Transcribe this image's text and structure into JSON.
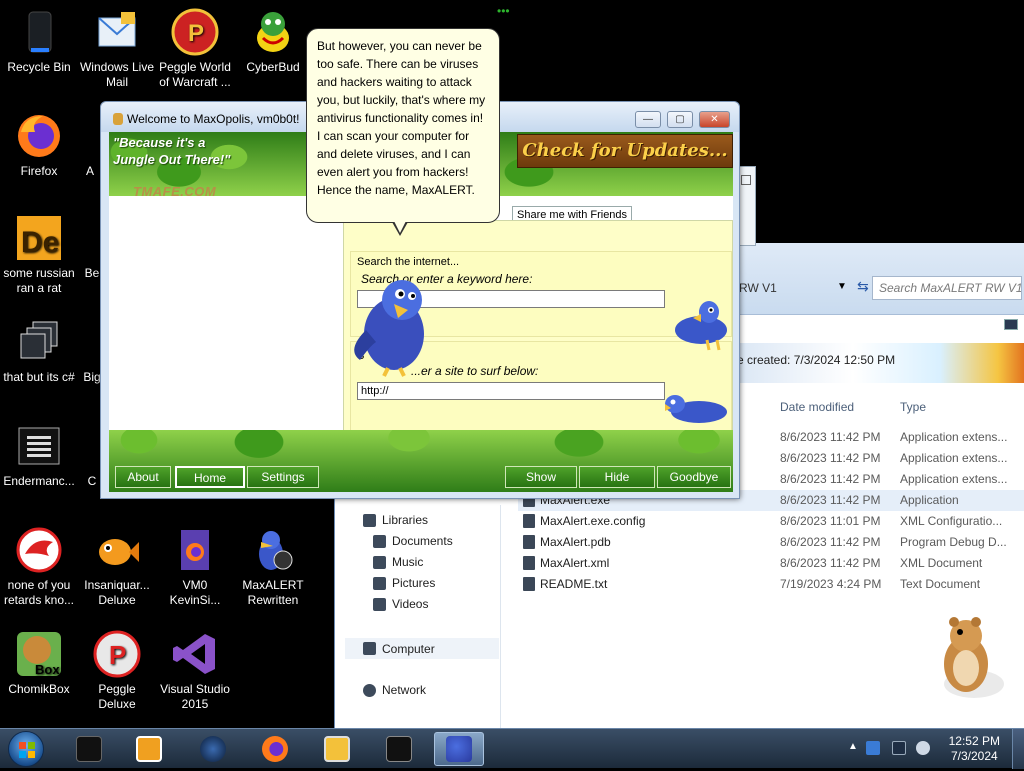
{
  "desktop": {
    "icons": [
      {
        "label": "Recycle Bin"
      },
      {
        "label": "Windows Live Mail"
      },
      {
        "label": "Peggle World of Warcraft ..."
      },
      {
        "label": "CyberBud"
      },
      {
        "label": "Firefox"
      },
      {
        "label": "A"
      },
      {
        "label": "some russian ran a rat"
      },
      {
        "label": "Be"
      },
      {
        "label": "that but its c#"
      },
      {
        "label": "Big"
      },
      {
        "label": "Endermanc..."
      },
      {
        "label": "C"
      },
      {
        "label": "none of you retards kno..."
      },
      {
        "label": "Insaniquar... Deluxe"
      },
      {
        "label": "VM0 KevinSi..."
      },
      {
        "label": "MaxALERT Rewritten"
      },
      {
        "label": "ChomikBox"
      },
      {
        "label": "Peggle Deluxe"
      },
      {
        "label": "Visual Studio 2015"
      }
    ]
  },
  "explorer": {
    "search_placeholder": "Search MaxALERT RW V1",
    "path_fragment": "RW V1",
    "date_created": "e created: 7/3/2024 12:50 PM",
    "columns": {
      "date": "Date modified",
      "type": "Type"
    },
    "files": [
      {
        "name": "",
        "date": "8/6/2023 11:42 PM",
        "type": "Application extens..."
      },
      {
        "name": "",
        "date": "8/6/2023 11:42 PM",
        "type": "Application extens..."
      },
      {
        "name": "",
        "date": "8/6/2023 11:42 PM",
        "type": "Application extens..."
      },
      {
        "name": "MaxAlert.exe",
        "date": "8/6/2023 11:42 PM",
        "type": "Application"
      },
      {
        "name": "MaxAlert.exe.config",
        "date": "8/6/2023 11:01 PM",
        "type": "XML Configuratio..."
      },
      {
        "name": "MaxAlert.pdb",
        "date": "8/6/2023 11:42 PM",
        "type": "Program Debug D..."
      },
      {
        "name": "MaxAlert.xml",
        "date": "8/6/2023 11:42 PM",
        "type": "XML Document"
      },
      {
        "name": "README.txt",
        "date": "7/19/2023 4:24 PM",
        "type": "Text Document"
      }
    ],
    "nav": {
      "libraries": "Libraries",
      "documents": "Documents",
      "music": "Music",
      "pictures": "Pictures",
      "videos": "Videos",
      "computer": "Computer",
      "network": "Network"
    }
  },
  "maxwin": {
    "title": "Welcome to MaxOpolis, vm0b0t!",
    "slogan": "\"Because it's a Jungle Out There!\"",
    "logo": "TMAFE.COM",
    "update_banner": "Check for Updates...",
    "tab_friends": "Share me with Friends",
    "search_title": "Search the internet...",
    "search_sub": "Search or enter a keyword here:",
    "search_value": "",
    "surf_title": "S",
    "surf_sub": "...er a site to surf below:",
    "surf_value": "http://",
    "buttons": {
      "about": "About",
      "home": "Home",
      "settings": "Settings",
      "show": "Show",
      "hide": "Hide",
      "goodbye": "Goodbye"
    }
  },
  "bubble": {
    "text": "But however, you can never be too safe. There can be viruses and hackers waiting to attack you, but luckily, that's where my antivirus functionality comes in! I can scan your computer for and delete viruses, and I can even alert you from hackers! Hence the name, MaxALERT."
  },
  "taskbar": {
    "time": "12:52 PM",
    "date": "7/3/2024"
  },
  "colors": {
    "jungle_green": "#3f9a1c",
    "panel_yellow": "#fefec8",
    "banner_text": "#fcd04a"
  }
}
